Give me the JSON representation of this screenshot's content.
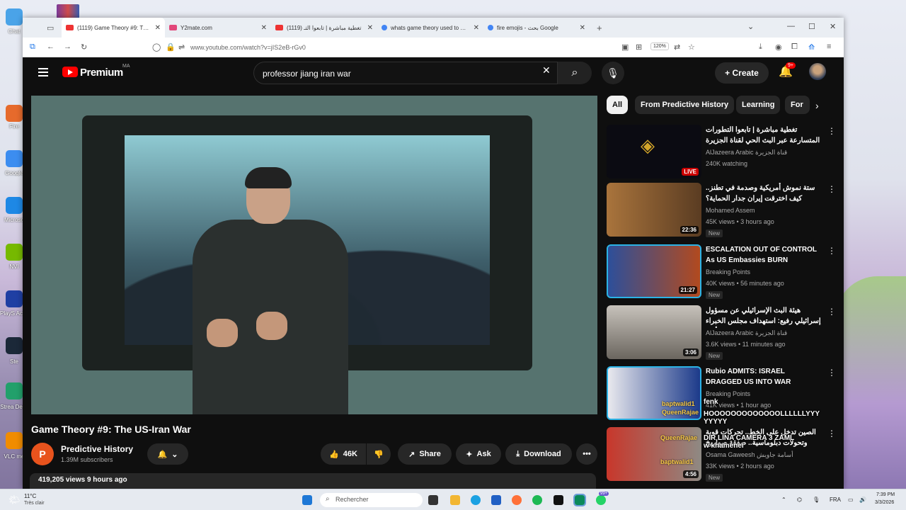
{
  "desktop": {
    "icons": [
      "Chat",
      "Fire",
      "Google",
      "Microso",
      "NVI",
      "PlayS Acces",
      "Ste",
      "Strea Desk",
      "VLC me"
    ]
  },
  "browser": {
    "tabs": [
      {
        "title": "(1119) Game Theory #9: The US",
        "active": true,
        "color": "#e33"
      },
      {
        "title": "Y2mate.com",
        "active": false,
        "color": "#e2477a"
      },
      {
        "title": "(1119) تغطية مباشرة | تابعوا التـ",
        "active": false,
        "color": "#e33"
      },
      {
        "title": "whats game theory used to unc",
        "active": false,
        "color": "#4285f4"
      },
      {
        "title": "fire emojis - بحث Google",
        "active": false,
        "color": "#4285f4"
      }
    ],
    "url": "www.youtube.com/watch?v=jIS2eB-rGv0",
    "zoom": "120%"
  },
  "youtube": {
    "logo_text": "Premium",
    "logo_region": "MA",
    "search_query": "professor jiang iran war",
    "create_label": "Create",
    "notif_count": "9+",
    "video": {
      "title": "Game Theory #9: The US-Iran War",
      "channel": "Predictive History",
      "channel_initial": "P",
      "subscribers": "1.39M subscribers",
      "likes": "46K",
      "share_label": "Share",
      "ask_label": "Ask",
      "download_label": "Download",
      "views_time": "419,205 views  9 hours ago"
    },
    "chips": [
      "All",
      "From Predictive History",
      "Learning",
      "For"
    ],
    "recommendations": [
      {
        "title": "تغطية مباشرة | تابعوا التطورات المتسارعة عبر البث الحي لقناة الجزيرة",
        "channel": "AlJazeera Arabic قناة الجزيرة",
        "meta": "240K watching",
        "badge": "LIVE",
        "duration": "",
        "new": "",
        "thumb": "#0b0b12"
      },
      {
        "title": "ستة نموش أمريكية وصدمة في تطنز.. كيف اخترقت إيران جدار الحماية؟",
        "channel": "Mohamed Assem",
        "meta": "45K views • 3 hours ago",
        "badge": "",
        "duration": "22:36",
        "new": "New",
        "thumb": "#7a5a32"
      },
      {
        "title": "ESCALATION OUT OF CONTROL As US Embassies BURN",
        "channel": "Breaking Points",
        "meta": "40K views • 56 minutes ago",
        "badge": "",
        "duration": "21:27",
        "new": "New",
        "thumb": "#5b2a1a"
      },
      {
        "title": "هيئة البث الإسرائيلي عن مسؤول إسرائيلي رفيع: استهداف مجلس الخبراء في إيران أثناء...",
        "channel": "AlJazeera Arabic قناة الجزيرة",
        "meta": "3.6K views • 11 minutes ago",
        "badge": "",
        "duration": "3:06",
        "new": "New",
        "thumb": "#7d7a76"
      },
      {
        "title": "Rubio ADMITS: ISRAEL DRAGGED US INTO WAR",
        "channel": "Breaking Points",
        "meta": "41K views • 1 hour ago",
        "badge": "",
        "duration": "16:52",
        "new": "",
        "thumb": "#31407a"
      },
      {
        "title": "الصين تدخل على الخط.. تحركات قوية وتحولات دبلوماسية.. صفقة صواريخ مضادة للسفن وتوترات",
        "channel": "Osama Gaweesh أسامة جاويش",
        "meta": "33K views • 2 hours ago",
        "badge": "",
        "duration": "4:56",
        "new": "New",
        "thumb": "#b23b2e"
      }
    ],
    "chat_overlay": [
      "fenk",
      "HOOOOOOOOOOOOOLLLLLLYYY",
      "YYYYY",
      "DIR LINA CAMERA 3 ZAML",
      "w khamenei"
    ],
    "thumb_text": [
      "baptwalid1",
      "QueenRajae",
      "QueenRajae",
      "baptwalid1"
    ]
  },
  "taskbar": {
    "weather_temp": "11°C",
    "weather_desc": "Très clair",
    "search_placeholder": "Rechercher",
    "lang": "FRA",
    "time": "7:39 PM",
    "date": "3/3/2026",
    "badge": "99+"
  }
}
